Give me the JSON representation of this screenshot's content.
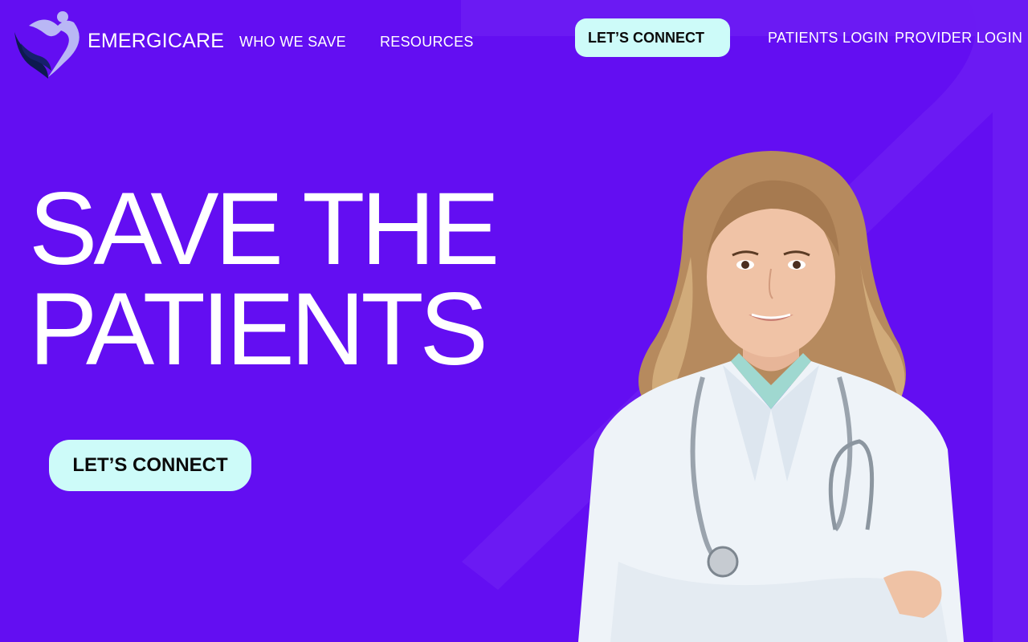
{
  "brand": {
    "name": "EMERGICARE",
    "logo_icon": "heart-hands-logo"
  },
  "nav": {
    "items": [
      {
        "label": "WHO WE SAVE"
      },
      {
        "label": "RESOURCES"
      }
    ],
    "cta_label": "LET’S CONNECT",
    "patients_login": "PATIENTS LOGIN",
    "provider_login": "PROVIDER LOGIN"
  },
  "hero": {
    "line1": "SAVE THE",
    "line2": "PATIENTS",
    "cta_label": "LET’S CONNECT",
    "image": "doctor-portrait"
  },
  "colors": {
    "background": "#630ef2",
    "accent_shape": "#6f1ff3",
    "button_bg": "#cdfbf9",
    "button_text": "#0b0b0b",
    "text": "#ffffff"
  }
}
